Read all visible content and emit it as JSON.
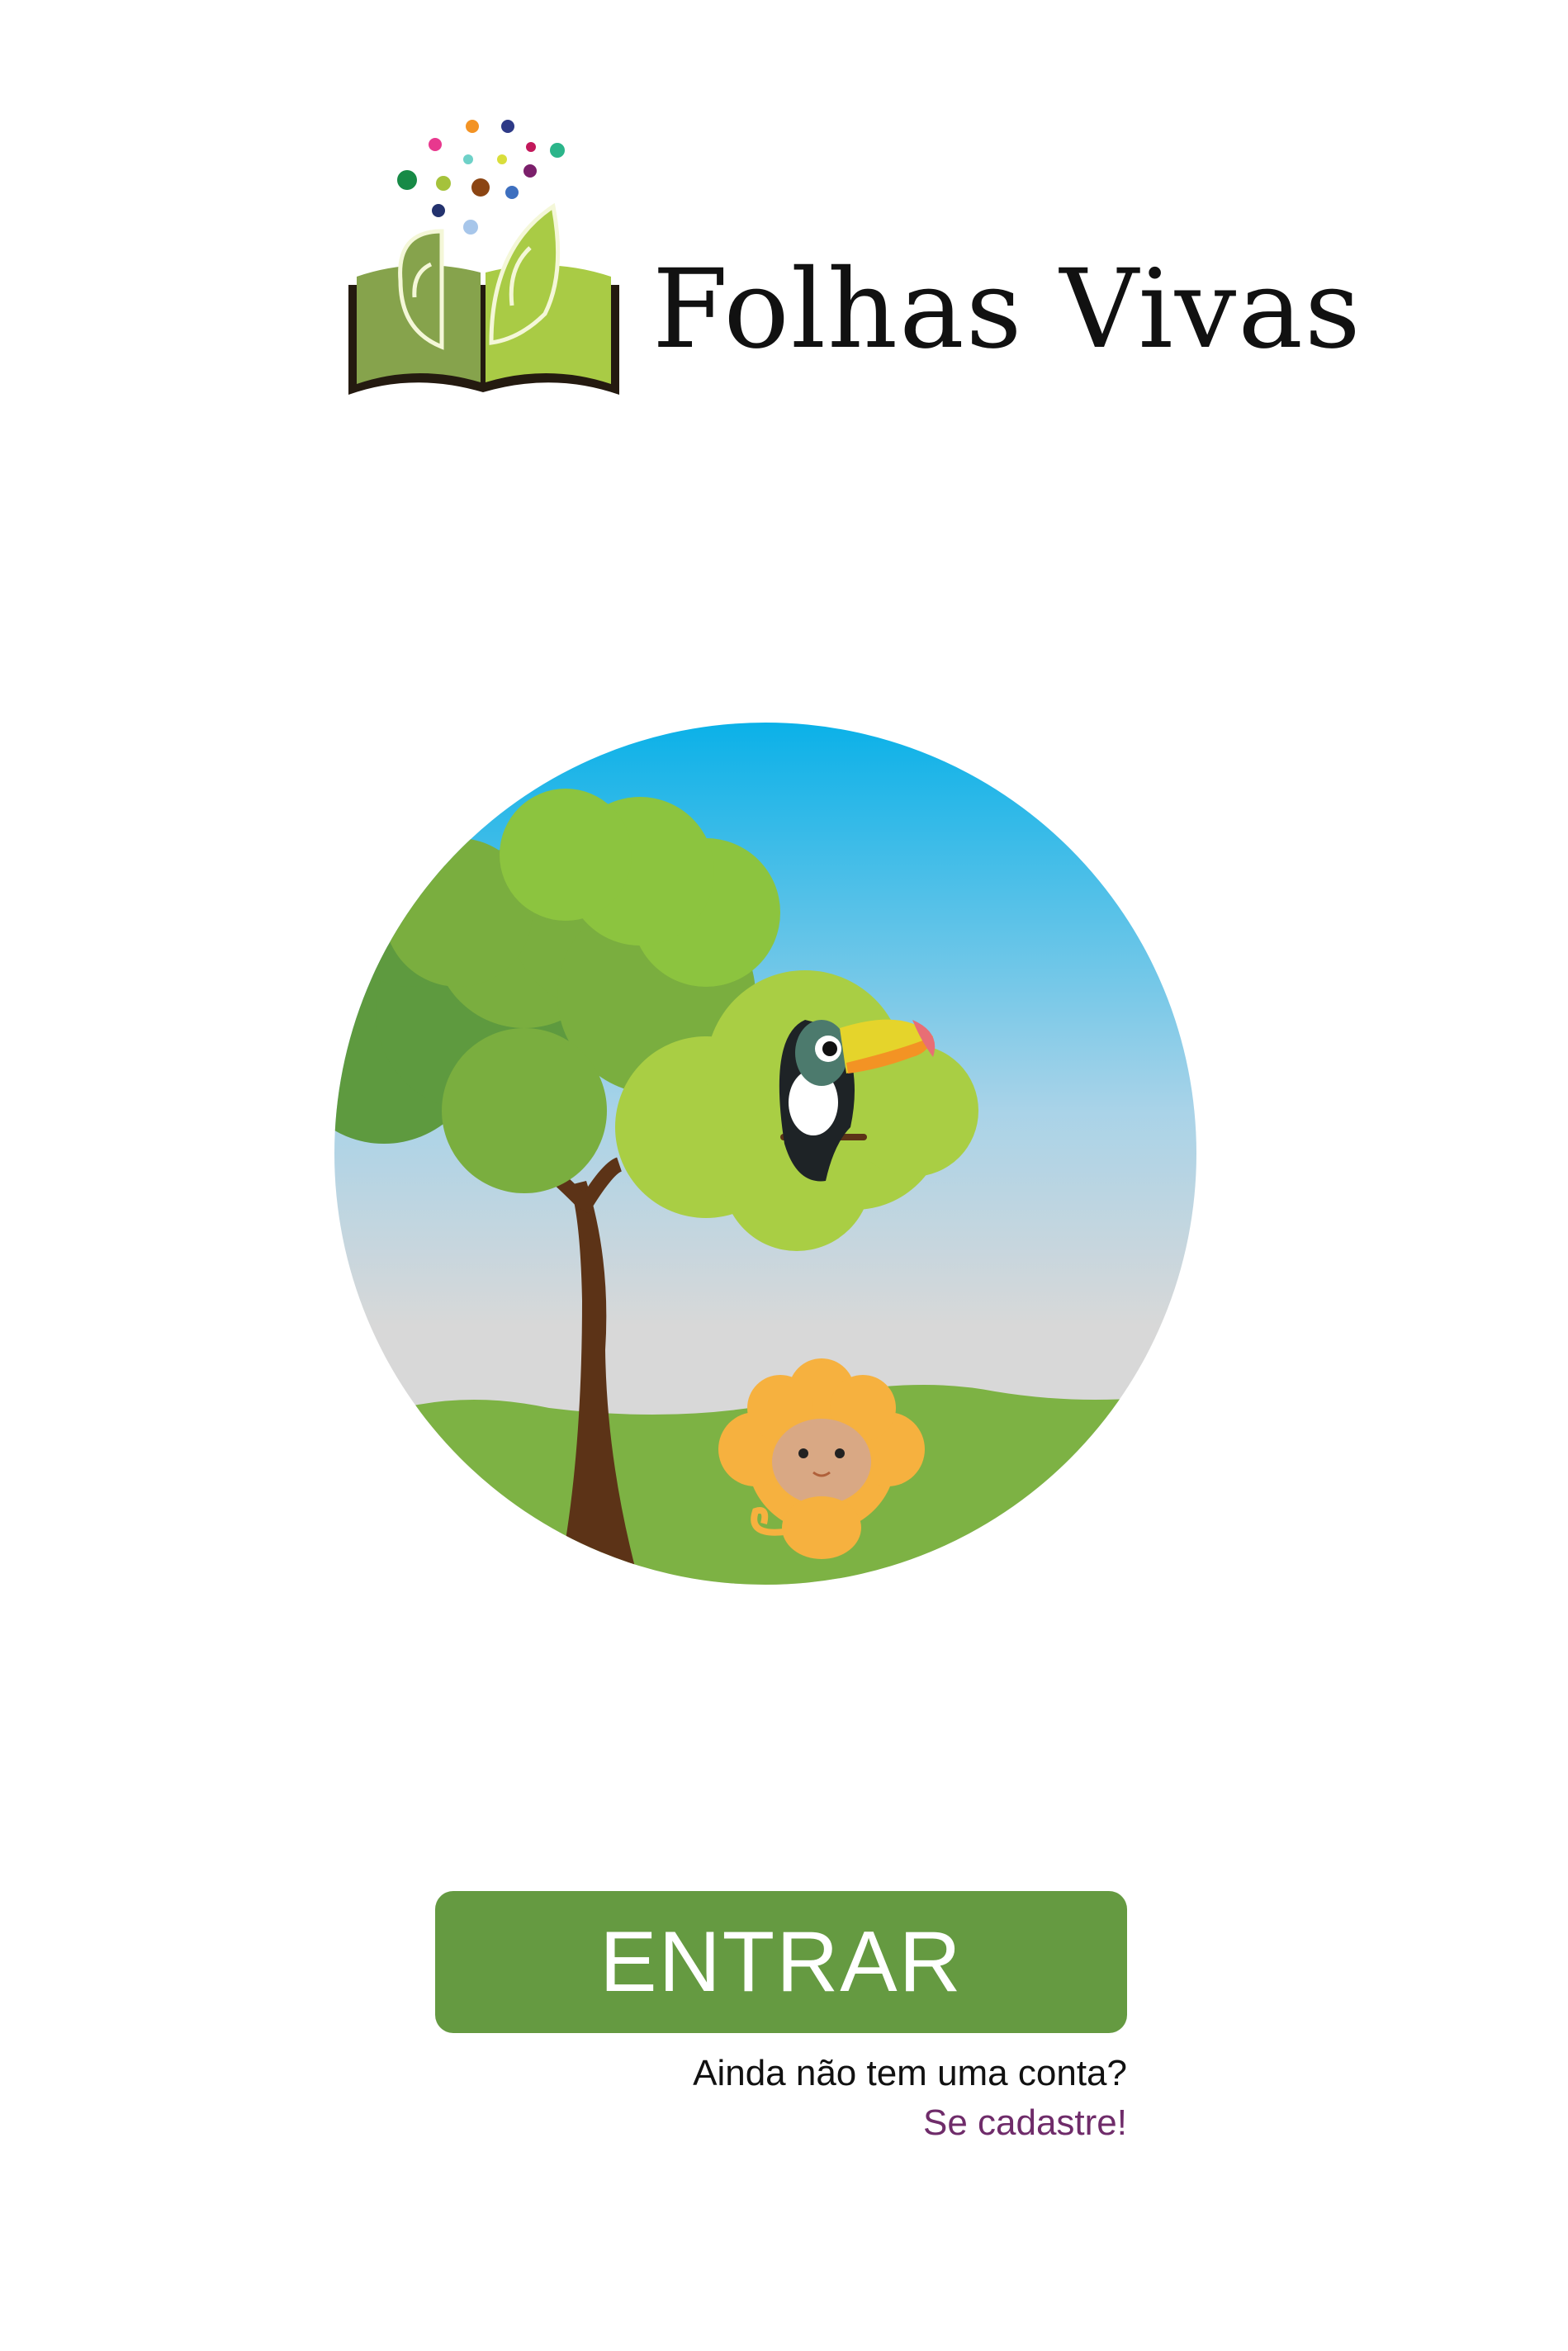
{
  "brand": {
    "name": "Folhas Vivas",
    "logo_icon": "book-with-leaves-icon"
  },
  "illustration": {
    "icon": "forest-scene-illustration",
    "elements": [
      "tree",
      "toucan",
      "golden-lion-tamarin"
    ]
  },
  "actions": {
    "enter_label": "ENTRAR",
    "signup_prompt": "Ainda não tem uma conta?",
    "signup_link": "Se cadastre!"
  },
  "colors": {
    "button_bg": "#659a41",
    "link": "#6f2c6a",
    "sky_top": "#0bb1e8",
    "sky_bottom": "#d8d8d8",
    "grass": "#7db244"
  }
}
